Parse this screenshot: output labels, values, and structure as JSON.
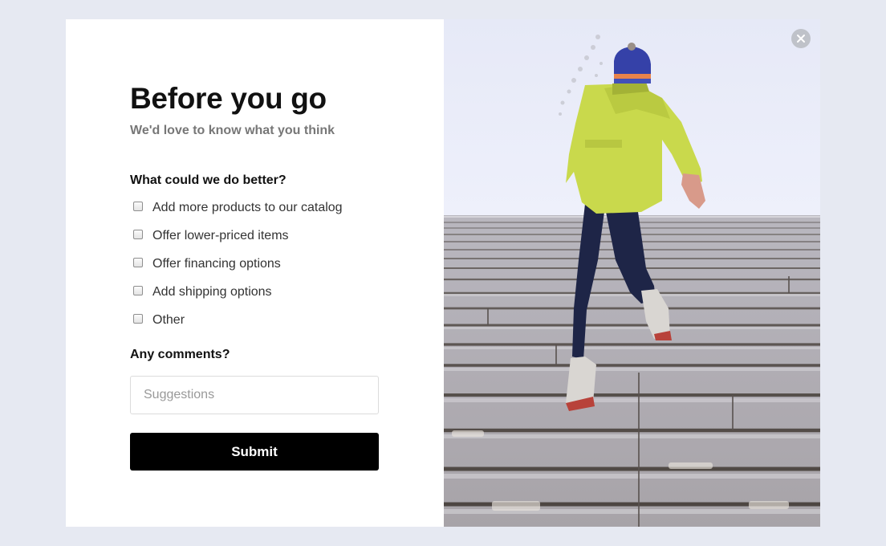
{
  "modal": {
    "title": "Before you go",
    "subtitle": "We'd love to know what you think"
  },
  "survey": {
    "question": "What could we do better?",
    "options": [
      {
        "label": "Add more products to our catalog",
        "checked": false
      },
      {
        "label": "Offer lower-priced items",
        "checked": false
      },
      {
        "label": "Offer financing options",
        "checked": false
      },
      {
        "label": "Add shipping options",
        "checked": false
      },
      {
        "label": "Other",
        "checked": false
      }
    ],
    "comments_label": "Any comments?",
    "comments_value": "",
    "comments_placeholder": "Suggestions",
    "submit_label": "Submit"
  },
  "icons": {
    "close": "close-icon"
  },
  "colors": {
    "page_background": "#e6e9f2",
    "modal_background": "#ffffff",
    "submit_background": "#000000",
    "submit_text": "#ffffff",
    "subtitle_text": "#777777",
    "close_button": "#bfc2c9"
  }
}
